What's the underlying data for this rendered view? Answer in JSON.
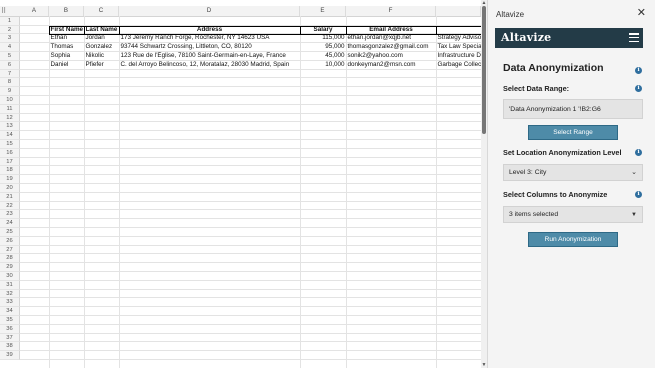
{
  "spreadsheet": {
    "corner_icon": "grid-dots-icon",
    "columns": [
      "A",
      "B",
      "C",
      "D",
      "E",
      "F",
      ""
    ],
    "rows": [
      "1",
      "2",
      "3",
      "4",
      "5",
      "6",
      "7",
      "8",
      "9",
      "10",
      "11",
      "12",
      "13",
      "14",
      "15",
      "16",
      "17",
      "18",
      "19",
      "20",
      "21",
      "22",
      "23",
      "24",
      "25",
      "26",
      "27",
      "28",
      "29",
      "30",
      "31",
      "32",
      "33",
      "34",
      "35",
      "36",
      "37",
      "38",
      "39"
    ],
    "table": {
      "headers": [
        "First Name",
        "Last Name",
        "Address",
        "Salary",
        "Email Address",
        ""
      ],
      "rows": [
        [
          "Ethan",
          "Jordan",
          "173 Jeremy Ranch Forge, Rochester, NY 14623 USA",
          "115,000",
          "ethan.jordan@xqjb.net",
          "Strategy Advisor"
        ],
        [
          "Thomas",
          "Gonzalez",
          "93744 Schwartz Crossing, Littleton, CO, 80120",
          "95,000",
          "thomasgonzalez@gmail.com",
          "Tax Law Special"
        ],
        [
          "Sophia",
          "Nikolic",
          "123 Rue de l'Église, 78100 Saint-Germain-en-Laye, France",
          "45,000",
          "sonik2@yahoo.com",
          "Infrastructure D"
        ],
        [
          "Daniel",
          "Pfiefer",
          "C. del Arroyo Belincoso, 12, Moratalaz, 28030 Madrid, Spain",
          "10,000",
          "donkeyman2@msn.com",
          "Garbage Collec"
        ]
      ]
    }
  },
  "taskpane": {
    "title": "Altavize",
    "close_icon": "close-icon",
    "brand": "Altavize",
    "menu_icon": "hamburger-menu-icon",
    "section_title": "Data Anonymization",
    "data_range_label": "Select Data Range:",
    "data_range_value": "'Data Anonymization 1 '!B2:G6",
    "select_range_button": "Select Range",
    "location_label": "Set Location Anonymization Level",
    "location_value": "Level 3: City",
    "columns_label": "Select Columns to Anonymize",
    "columns_value": "3 items selected",
    "run_button": "Run Anonymization",
    "info_icon_glyph": "i",
    "brand_color": "#233b47",
    "button_color": "#4e8ba8",
    "info_color": "#2f6e9e"
  }
}
